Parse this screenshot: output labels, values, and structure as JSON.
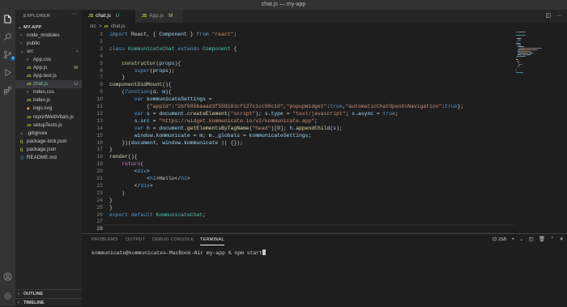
{
  "window": {
    "title": "chat.js — my-app"
  },
  "activity_bar": {
    "items": [
      "files-icon",
      "search-icon",
      "source-control-icon",
      "run-debug-icon",
      "extensions-icon"
    ],
    "source_control_badge": "3",
    "bottom": [
      "account-icon",
      "settings-gear-icon"
    ]
  },
  "explorer": {
    "header": "EXPLORER",
    "project": "MY-APP",
    "tree": [
      {
        "name": "node_modules",
        "type": "folder",
        "depth": 1,
        "open": false,
        "status": ""
      },
      {
        "name": "public",
        "type": "folder",
        "depth": 1,
        "open": false,
        "status": ""
      },
      {
        "name": "src",
        "type": "folder",
        "depth": 1,
        "open": true,
        "status": "•"
      },
      {
        "name": "App.css",
        "type": "css",
        "depth": 2,
        "status": ""
      },
      {
        "name": "App.js",
        "type": "js",
        "depth": 2,
        "status": "M"
      },
      {
        "name": "App.test.js",
        "type": "js",
        "depth": 2,
        "status": ""
      },
      {
        "name": "chat.js",
        "type": "js",
        "depth": 2,
        "status": "U",
        "selected": true
      },
      {
        "name": "index.css",
        "type": "css",
        "depth": 2,
        "status": ""
      },
      {
        "name": "index.js",
        "type": "js",
        "depth": 2,
        "status": ""
      },
      {
        "name": "logo.svg",
        "type": "svg",
        "depth": 2,
        "status": ""
      },
      {
        "name": "reportWebVitals.js",
        "type": "js",
        "depth": 2,
        "status": ""
      },
      {
        "name": "setupTests.js",
        "type": "js",
        "depth": 2,
        "status": ""
      },
      {
        "name": ".gitignore",
        "type": "git",
        "depth": 1,
        "status": ""
      },
      {
        "name": "package-lock.json",
        "type": "json",
        "depth": 1,
        "status": ""
      },
      {
        "name": "package.json",
        "type": "json",
        "depth": 1,
        "status": ""
      },
      {
        "name": "README.md",
        "type": "md",
        "depth": 1,
        "status": ""
      }
    ],
    "outline": "OUTLINE",
    "timeline": "TIMELINE"
  },
  "tabs": [
    {
      "label": "chat.js",
      "marker": "U",
      "active": true
    },
    {
      "label": "App.js",
      "marker": "M",
      "active": false
    }
  ],
  "breadcrumb": {
    "folder": "src",
    "file": "chat.js",
    "sep": ">"
  },
  "code": {
    "current_line": 28,
    "lines": [
      [
        [
          "kw",
          "import "
        ],
        [
          "pl",
          "React, { "
        ],
        [
          "var",
          "Component"
        ],
        [
          "pl",
          " } "
        ],
        [
          "kw",
          "from "
        ],
        [
          "str",
          "\"react\""
        ],
        [
          "pl",
          ";"
        ]
      ],
      [],
      [
        [
          "kw",
          "class "
        ],
        [
          "cls",
          "KommunicateChat "
        ],
        [
          "kw",
          "extends "
        ],
        [
          "cls",
          "Component"
        ],
        [
          "pl",
          " {"
        ]
      ],
      [],
      [
        [
          "pl",
          "    "
        ],
        [
          "fn",
          "constructor"
        ],
        [
          "pl",
          "("
        ],
        [
          "var",
          "props"
        ],
        [
          "pl",
          "){"
        ]
      ],
      [
        [
          "pl",
          "        "
        ],
        [
          "kw",
          "super"
        ],
        [
          "pl",
          "("
        ],
        [
          "var",
          "props"
        ],
        [
          "pl",
          ");"
        ]
      ],
      [
        [
          "pl",
          "    }"
        ]
      ],
      [
        [
          "fn",
          "componentDidMount"
        ],
        [
          "pl",
          "(){"
        ]
      ],
      [
        [
          "pl",
          "    ("
        ],
        [
          "kw",
          "function"
        ],
        [
          "pl",
          "("
        ],
        [
          "var",
          "d"
        ],
        [
          "pl",
          ", "
        ],
        [
          "var",
          "m"
        ],
        [
          "pl",
          "){"
        ]
      ],
      [
        [
          "pl",
          "        "
        ],
        [
          "kw",
          "var "
        ],
        [
          "var",
          "kommunicateSettings"
        ],
        [
          "pl",
          " ="
        ]
      ],
      [
        [
          "pl",
          "            {"
        ],
        [
          "str",
          "\"appId\""
        ],
        [
          "pl",
          ":"
        ],
        [
          "str",
          "\"2bf085baaad3f559103cf127c1cc98c10\""
        ],
        [
          "pl",
          ","
        ],
        [
          "str",
          "\"popupWidget\""
        ],
        [
          "pl",
          ":"
        ],
        [
          "kw",
          "true"
        ],
        [
          "pl",
          ","
        ],
        [
          "str",
          "\"automaticChatOpenOnNavigation\""
        ],
        [
          "pl",
          ":"
        ],
        [
          "kw",
          "true"
        ],
        [
          "pl",
          "};"
        ]
      ],
      [
        [
          "pl",
          "        "
        ],
        [
          "kw",
          "var "
        ],
        [
          "var",
          "s"
        ],
        [
          "pl",
          " = "
        ],
        [
          "var",
          "document"
        ],
        [
          "pl",
          "."
        ],
        [
          "fn",
          "createElement"
        ],
        [
          "pl",
          "("
        ],
        [
          "str",
          "\"script\""
        ],
        [
          "pl",
          "); "
        ],
        [
          "var",
          "s"
        ],
        [
          "pl",
          "."
        ],
        [
          "var",
          "type"
        ],
        [
          "pl",
          " = "
        ],
        [
          "str",
          "\"text/javascript\""
        ],
        [
          "pl",
          "; "
        ],
        [
          "var",
          "s"
        ],
        [
          "pl",
          "."
        ],
        [
          "var",
          "async"
        ],
        [
          "pl",
          " = "
        ],
        [
          "kw",
          "true"
        ],
        [
          "pl",
          ";"
        ]
      ],
      [
        [
          "pl",
          "        "
        ],
        [
          "var",
          "s"
        ],
        [
          "pl",
          "."
        ],
        [
          "var",
          "src"
        ],
        [
          "pl",
          " = "
        ],
        [
          "str",
          "\"https://widget.kommunicate.io/v2/kommunicate.app\""
        ],
        [
          "pl",
          ";"
        ]
      ],
      [
        [
          "pl",
          "        "
        ],
        [
          "kw",
          "var "
        ],
        [
          "var",
          "h"
        ],
        [
          "pl",
          " = "
        ],
        [
          "var",
          "document"
        ],
        [
          "pl",
          "."
        ],
        [
          "fn",
          "getElementsByTagName"
        ],
        [
          "pl",
          "("
        ],
        [
          "str",
          "\"head\""
        ],
        [
          "pl",
          ")[0]; "
        ],
        [
          "var",
          "h"
        ],
        [
          "pl",
          "."
        ],
        [
          "fn",
          "appendChild"
        ],
        [
          "pl",
          "("
        ],
        [
          "var",
          "s"
        ],
        [
          "pl",
          ");"
        ]
      ],
      [
        [
          "pl",
          "        "
        ],
        [
          "var",
          "window"
        ],
        [
          "pl",
          "."
        ],
        [
          "var",
          "kommunicate"
        ],
        [
          "pl",
          " = "
        ],
        [
          "var",
          "m"
        ],
        [
          "pl",
          "; "
        ],
        [
          "var",
          "m"
        ],
        [
          "pl",
          "."
        ],
        [
          "var",
          "_globals"
        ],
        [
          "pl",
          " = "
        ],
        [
          "var",
          "kommunicateSettings"
        ],
        [
          "pl",
          ";"
        ]
      ],
      [
        [
          "pl",
          "    })("
        ],
        [
          "var",
          "document"
        ],
        [
          "pl",
          ", "
        ],
        [
          "var",
          "window"
        ],
        [
          "pl",
          "."
        ],
        [
          "var",
          "kommunicate"
        ],
        [
          "pl",
          " || {});"
        ]
      ],
      [
        [
          "pl",
          "}"
        ]
      ],
      [
        [
          "fn",
          "render"
        ],
        [
          "pl",
          "(){"
        ]
      ],
      [
        [
          "pl",
          "    "
        ],
        [
          "kw2",
          "return"
        ],
        [
          "pl",
          "("
        ]
      ],
      [
        [
          "pl",
          "        <"
        ],
        [
          "tag",
          "div"
        ],
        [
          "pl",
          ">"
        ]
      ],
      [
        [
          "pl",
          "            <"
        ],
        [
          "tag",
          "h1"
        ],
        [
          "pl",
          ">Hello</"
        ],
        [
          "tag",
          "h1"
        ],
        [
          "pl",
          ">"
        ]
      ],
      [
        [
          "pl",
          "        </"
        ],
        [
          "tag",
          "div"
        ],
        [
          "pl",
          ">"
        ]
      ],
      [
        [
          "pl",
          "    )"
        ]
      ],
      [
        [
          "pl",
          "}"
        ]
      ],
      [
        [
          "pl",
          "}"
        ]
      ],
      [
        [
          "kw",
          "export "
        ],
        [
          "kw",
          "default "
        ],
        [
          "cls",
          "KommunicateChat"
        ],
        [
          "pl",
          ";"
        ]
      ],
      [],
      []
    ]
  },
  "panel": {
    "tabs": [
      "PROBLEMS",
      "OUTPUT",
      "DEBUG CONSOLE",
      "TERMINAL"
    ],
    "active_tab": "TERMINAL",
    "shell": "zsh",
    "terminal_line": "kommunicate@kommunicates-MacBook-Air my-app % npm start"
  },
  "colors": {
    "accent": "#0e639c",
    "editor_bg": "#1e1e1e",
    "sidebar_bg": "#252526",
    "activity_bg": "#333333"
  }
}
